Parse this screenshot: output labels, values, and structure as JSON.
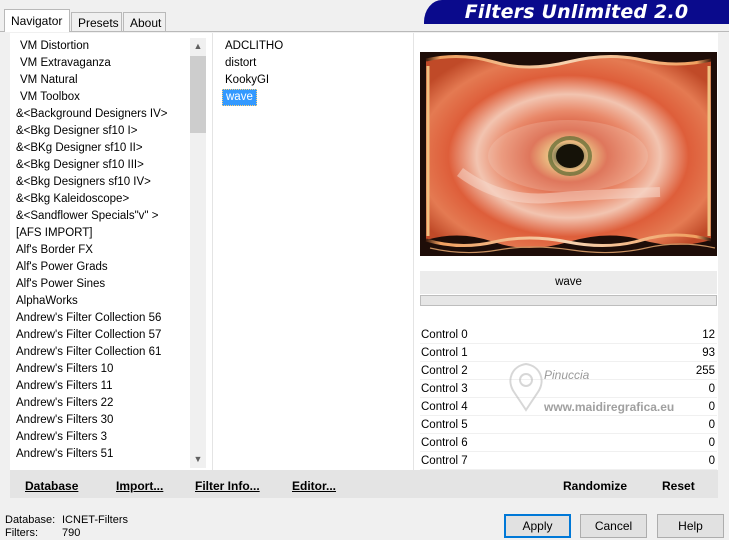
{
  "tabs": [
    {
      "label": "Navigator"
    },
    {
      "label": "Presets"
    },
    {
      "label": "About"
    }
  ],
  "banner": {
    "title": "Filters Unlimited 2.0"
  },
  "categories": [
    "VM Distortion",
    "VM Extravaganza",
    "VM Natural",
    "VM Toolbox",
    "&<Background Designers IV>",
    "&<Bkg Designer sf10 I>",
    "&<BKg Designer sf10 II>",
    "&<Bkg Designer sf10 III>",
    "&<Bkg Designers sf10 IV>",
    "&<Bkg Kaleidoscope>",
    "&<Sandflower Specials\"v\" >",
    "[AFS IMPORT]",
    "Alf's Border FX",
    "Alf's Power Grads",
    "Alf's Power Sines",
    "AlphaWorks",
    "Andrew's Filter Collection 56",
    "Andrew's Filter Collection 57",
    "Andrew's Filter Collection 61",
    "Andrew's Filters 10",
    "Andrew's Filters 11",
    "Andrew's Filters 22",
    "Andrew's Filters 30",
    "Andrew's Filters 3",
    "Andrew's Filters 51"
  ],
  "filters": [
    "ADCLITHO",
    "distort",
    "KookyGI",
    "wave"
  ],
  "selected_filter": "wave",
  "controls": [
    {
      "label": "Control 0",
      "value": "12"
    },
    {
      "label": "Control 1",
      "value": "93"
    },
    {
      "label": "Control 2",
      "value": "255"
    },
    {
      "label": "Control 3",
      "value": "0"
    },
    {
      "label": "Control 4",
      "value": "0"
    },
    {
      "label": "Control 5",
      "value": "0"
    },
    {
      "label": "Control 6",
      "value": "0"
    },
    {
      "label": "Control 7",
      "value": "0"
    }
  ],
  "actions": {
    "database": "Database",
    "import": "Import...",
    "filter_info": "Filter Info...",
    "editor": "Editor...",
    "randomize": "Randomize",
    "reset": "Reset"
  },
  "info": {
    "database_label": "Database:",
    "database_value": "ICNET-Filters",
    "filters_label": "Filters:",
    "filters_value": "790"
  },
  "buttons": {
    "apply": "Apply",
    "cancel": "Cancel",
    "help": "Help"
  },
  "watermark": {
    "line1": "Pinuccia",
    "line2": "www.maidiregrafica.eu"
  },
  "colors": {
    "banner": "#0a0a8c",
    "selection": "#3399ff"
  }
}
